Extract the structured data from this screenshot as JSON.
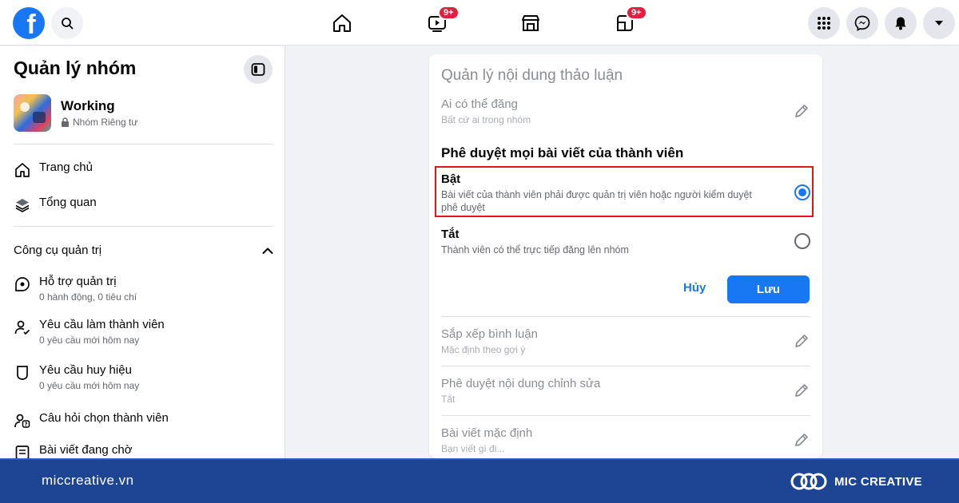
{
  "topbar": {
    "logo_letter": "f",
    "video_badge": "9+",
    "gaming_badge": "9+"
  },
  "sidebar": {
    "title": "Quản lý nhóm",
    "group": {
      "name": "Working",
      "privacy": "Nhóm Riêng tư"
    },
    "nav": [
      {
        "label": "Trang chủ",
        "icon": "home-icon"
      },
      {
        "label": "Tổng quan",
        "icon": "layers-icon"
      }
    ],
    "admin_tools_label": "Công cụ quản trị",
    "admin_items": [
      {
        "label": "Hỗ trợ quản trị",
        "sub": "0 hành động, 0 tiêu chí",
        "icon": "admin-assist-icon"
      },
      {
        "label": "Yêu cầu làm thành viên",
        "sub": "0 yêu cầu mới hôm nay",
        "icon": "member-request-icon"
      },
      {
        "label": "Yêu cầu huy hiệu",
        "sub": "0 yêu cầu mới hôm nay",
        "icon": "badge-icon"
      },
      {
        "label": "Câu hỏi chọn thành viên",
        "sub": "",
        "icon": "question-icon"
      },
      {
        "label": "Bài viết đang chờ",
        "sub": "",
        "icon": "pending-posts-icon"
      }
    ]
  },
  "card": {
    "title": "Quản lý nội dung thảo luận",
    "who_can_post": {
      "title": "Ai có thể đăng",
      "sub": "Bất cứ ai trong nhóm"
    },
    "approve_section_title": "Phê duyệt mọi bài viết của thành viên",
    "option_on": {
      "title": "Bật",
      "sub": "Bài viết của thành viên phải được quản trị viên hoặc người kiểm duyệt phê duyệt"
    },
    "option_off": {
      "title": "Tắt",
      "sub": "Thành viên có thể trực tiếp đăng lên nhóm"
    },
    "cancel_label": "Hủy",
    "save_label": "Lưu",
    "sort_comments": {
      "title": "Sắp xếp bình luận",
      "sub": "Mặc định theo gợi ý"
    },
    "approve_edits": {
      "title": "Phê duyệt nội dung chỉnh sửa",
      "sub": "Tắt"
    },
    "default_post": {
      "title": "Bài viết mặc định",
      "sub": "Bạn viết gì đi..."
    }
  },
  "footer": {
    "url": "miccreative.vn",
    "brand": "MIC CREATIVE"
  },
  "colors": {
    "accent": "#1877f2",
    "highlight": "#e0161b",
    "footer_bg": "#1e4494"
  }
}
